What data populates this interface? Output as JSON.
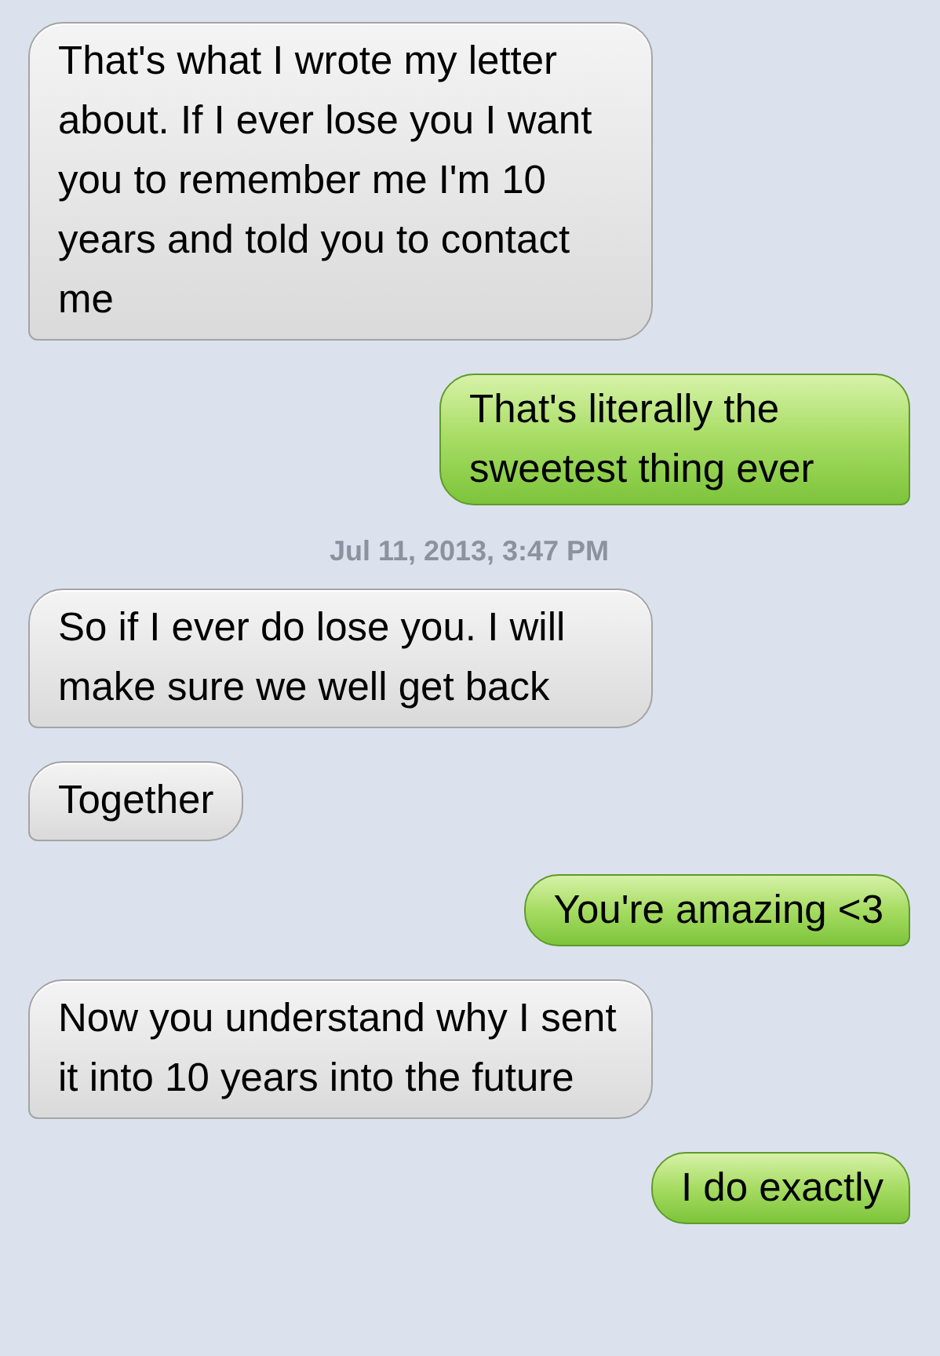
{
  "messages": [
    {
      "kind": "incoming",
      "text": "That's what I wrote my letter about. If I ever lose you I want you to remember me I'm 10 years and told you to contact me"
    },
    {
      "kind": "outgoing",
      "text": "That's literally the sweetest thing ever"
    },
    {
      "kind": "timestamp",
      "text": "Jul 11, 2013, 3:47 PM"
    },
    {
      "kind": "incoming",
      "text": "So if I ever do lose you. I will make sure we well get back"
    },
    {
      "kind": "incoming",
      "text": "Together"
    },
    {
      "kind": "outgoing",
      "text": "You're amazing <3"
    },
    {
      "kind": "incoming",
      "text": "Now you understand why I sent it into 10 years into the future"
    },
    {
      "kind": "outgoing",
      "text": "I do exactly"
    }
  ]
}
